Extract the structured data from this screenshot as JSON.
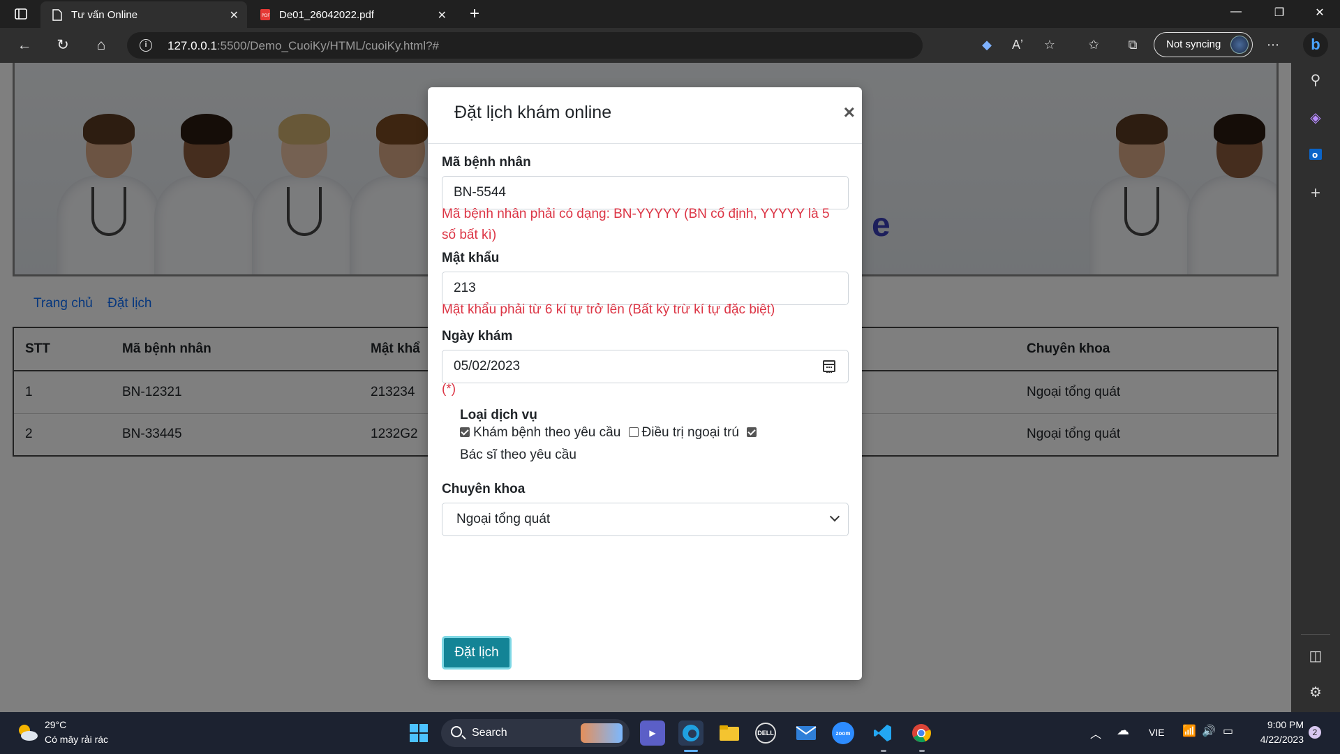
{
  "browser": {
    "tabs": [
      {
        "title": "Tư vấn Online",
        "active": true
      },
      {
        "title": "De01_26042022.pdf",
        "active": false
      }
    ],
    "url_host": "127.0.0.1",
    "url_path": ":5500/Demo_CuoiKy/HTML/cuoiKy.html?#",
    "sync_label": "Not syncing"
  },
  "page": {
    "banner_partial_text": "e",
    "nav": [
      {
        "label": "Trang chủ"
      },
      {
        "label": "Đặt lịch"
      }
    ],
    "table": {
      "headers": [
        "STT",
        "Mã bệnh nhân",
        "Mật khẩ",
        "Chuyên khoa"
      ],
      "rows": [
        {
          "stt": "1",
          "ma": "BN-12321",
          "mk": "213234",
          "ck": "Ngoại tổng quát"
        },
        {
          "stt": "2",
          "ma": "BN-33445",
          "mk": "1232G2",
          "ck": "Ngoại tổng quát"
        }
      ]
    }
  },
  "modal": {
    "title": "Đặt lịch khám online",
    "close_symbol": "×",
    "patient_id": {
      "label": "Mã bệnh nhân",
      "value": "BN-5544",
      "error_line1": "Mã bệnh nhân phải có dạng: BN-YYYYY (BN cố định, YYYYY là 5",
      "error_line2": "số bất kì)"
    },
    "password": {
      "label": "Mật khẩu",
      "value": "213",
      "error": "Mật khẩu phải từ 6 kí tự trở lên (Bất kỳ trừ kí tự đặc biệt)"
    },
    "date": {
      "label": "Ngày khám",
      "value": "05/02/2023",
      "note": "(*)"
    },
    "services": {
      "label": "Loại dịch vụ",
      "options": [
        {
          "label": "Khám bệnh theo yêu cầu",
          "checked": true
        },
        {
          "label": "Điều trị ngoại trú",
          "checked": false
        },
        {
          "label": "Bác sĩ theo yêu cầu",
          "checked": true
        }
      ]
    },
    "specialty": {
      "label": "Chuyên khoa",
      "selected": "Ngoại tổng quát"
    },
    "submit_label": "Đặt lịch"
  },
  "taskbar": {
    "weather_temp": "29°C",
    "weather_desc": "Có mây rải rác",
    "search_label": "Search",
    "language": "VIE",
    "time": "9:00 PM",
    "date": "4/22/2023",
    "notification_count": "2"
  },
  "colors": {
    "error": "#dc3545",
    "link": "#0d6efd",
    "submit_bg": "#138496"
  }
}
